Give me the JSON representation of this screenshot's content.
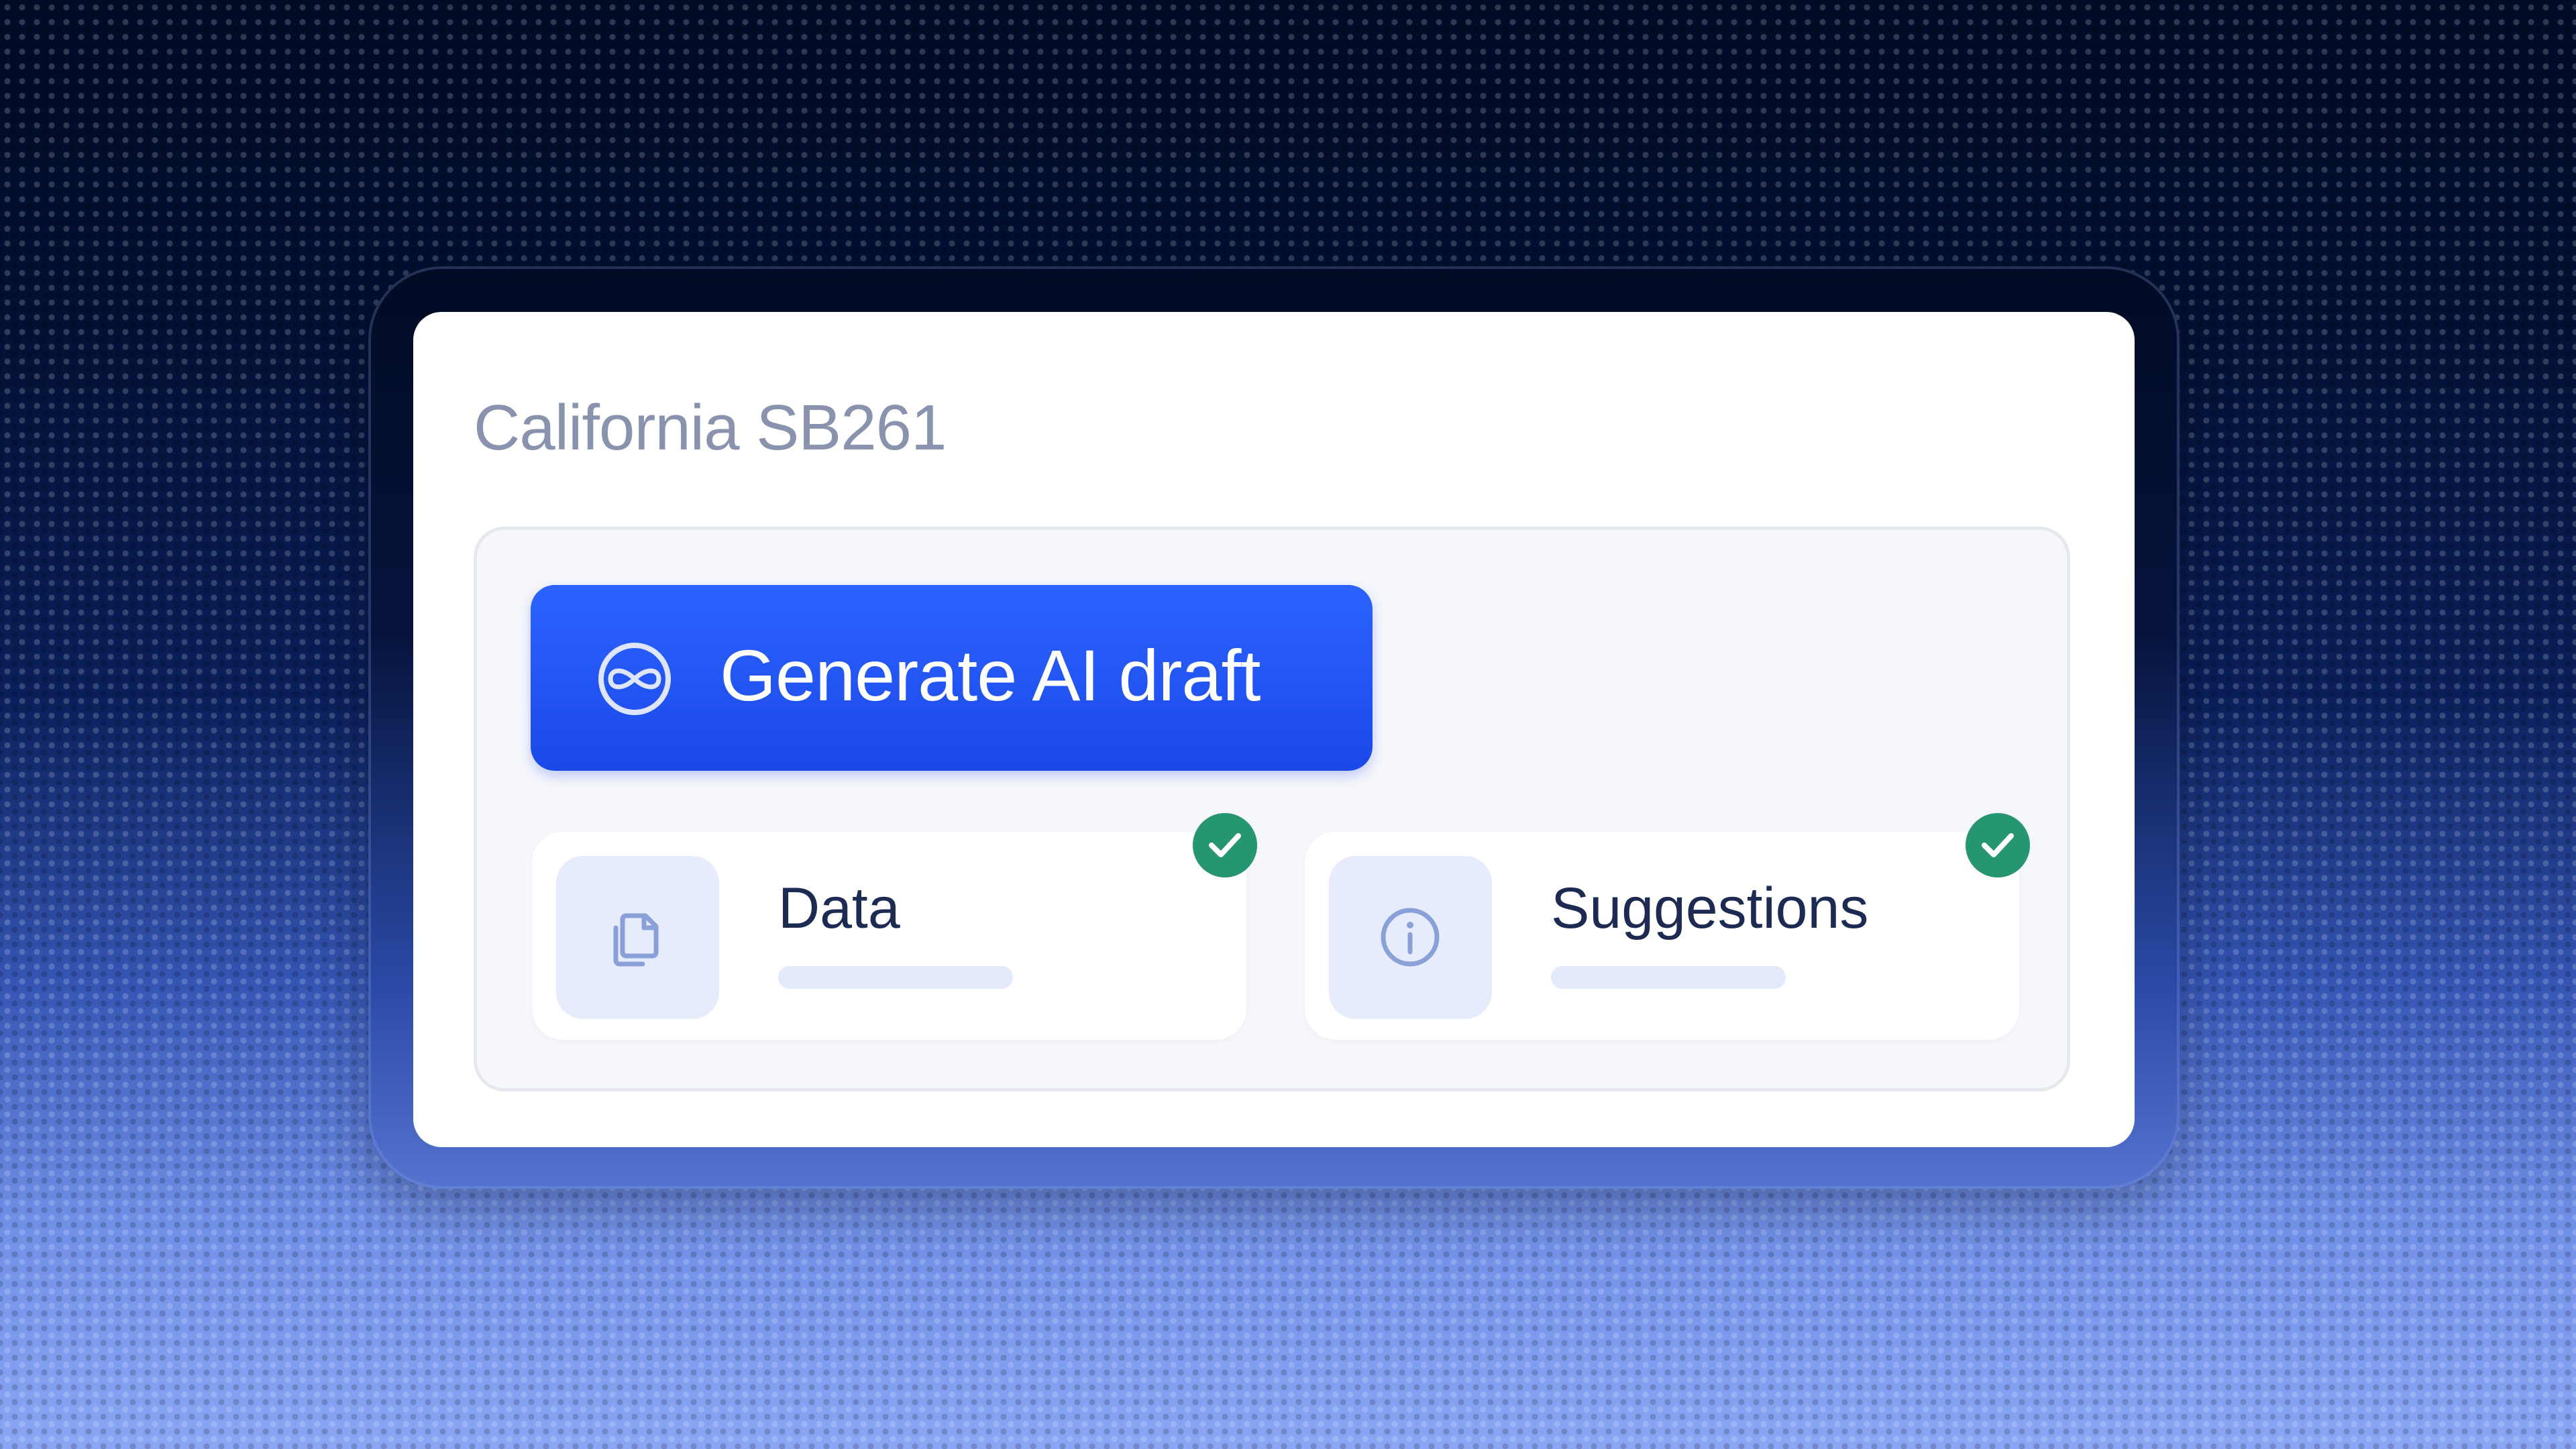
{
  "panel": {
    "title": "California SB261"
  },
  "generate_button": {
    "label": "Generate AI draft",
    "icon": "infinity-circle-icon"
  },
  "cards": [
    {
      "label": "Data",
      "icon": "document-copy-icon",
      "status": "complete",
      "status_icon": "check-icon"
    },
    {
      "label": "Suggestions",
      "icon": "info-icon",
      "status": "complete",
      "status_icon": "check-icon"
    }
  ],
  "colors": {
    "accent": "#2c63ff",
    "success": "#25966f",
    "title_text": "#8a93ad",
    "card_text": "#1d2a52",
    "background_dark": "#020b26",
    "background_light": "#8aa6f4"
  }
}
